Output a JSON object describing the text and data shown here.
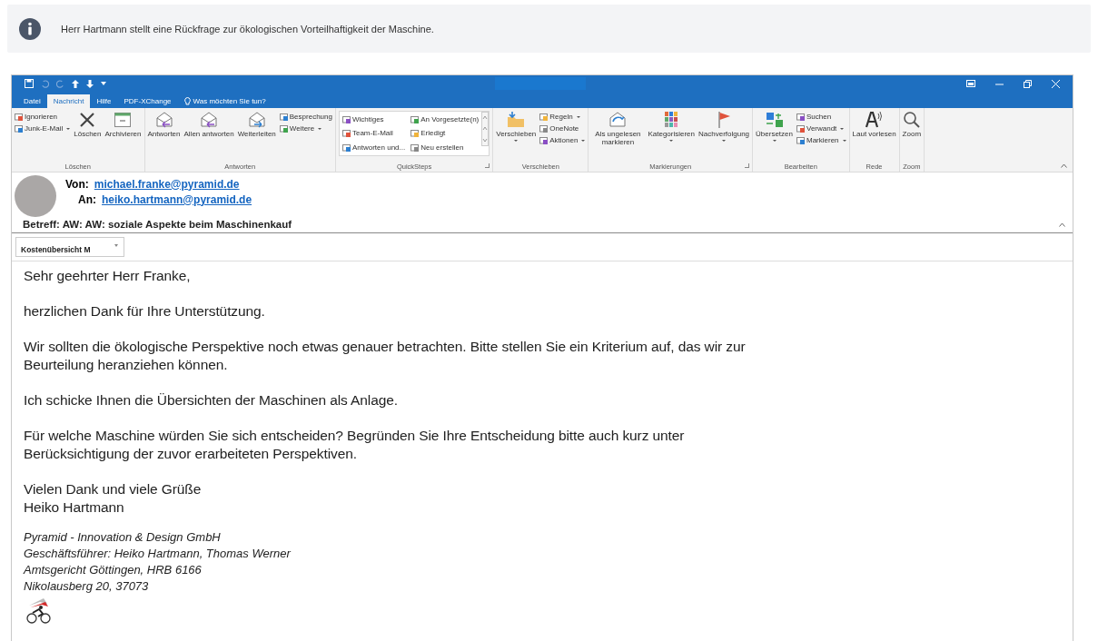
{
  "info_banner": {
    "text": "Herr Hartmann stellt eine Rückfrage zur ökologischen Vorteilhaftigkeit der Maschine."
  },
  "window": {
    "tabs": [
      {
        "label": "Datei",
        "selected": false
      },
      {
        "label": "Nachricht",
        "selected": true
      },
      {
        "label": "Hilfe",
        "selected": false
      },
      {
        "label": "PDF-XChange",
        "selected": false
      }
    ],
    "tell_me": "Was möchten Sie tun?"
  },
  "ribbon": {
    "groups": [
      {
        "label": "Löschen",
        "launcher": false,
        "items": [
          {
            "kind": "stack",
            "items": [
              {
                "label": "Ignorieren",
                "dropdown": false
              },
              {
                "label": "Junk-E-Mail",
                "dropdown": true
              }
            ]
          },
          {
            "kind": "large",
            "label": "Löschen",
            "dropdown": false
          },
          {
            "kind": "large",
            "label": "Archivieren",
            "dropdown": false
          }
        ]
      },
      {
        "label": "Antworten",
        "launcher": false,
        "items": [
          {
            "kind": "large",
            "label": "Antworten",
            "dropdown": false
          },
          {
            "kind": "large",
            "label": "Allen antworten",
            "dropdown": false
          },
          {
            "kind": "large",
            "label": "Weiterleiten",
            "dropdown": false
          },
          {
            "kind": "stack",
            "items": [
              {
                "label": "Besprechung",
                "dropdown": false
              },
              {
                "label": "Weitere",
                "dropdown": true
              }
            ]
          }
        ]
      },
      {
        "label": "QuickSteps",
        "launcher": true,
        "items": [
          {
            "kind": "gallery",
            "items": [
              {
                "label": "Wichtiges"
              },
              {
                "label": "Team-E-Mail"
              },
              {
                "label": "Antworten und..."
              },
              {
                "label": "An Vorgesetzte(n)"
              },
              {
                "label": "Erledigt"
              },
              {
                "label": "Neu erstellen"
              }
            ]
          }
        ]
      },
      {
        "label": "Verschieben",
        "launcher": false,
        "items": [
          {
            "kind": "large",
            "label": "Verschieben",
            "dropdown": true
          },
          {
            "kind": "stack",
            "items": [
              {
                "label": "Regeln",
                "dropdown": true
              },
              {
                "label": "OneNote",
                "dropdown": false
              },
              {
                "label": "Aktionen",
                "dropdown": true
              }
            ]
          }
        ]
      },
      {
        "label": "Markierungen",
        "launcher": true,
        "items": [
          {
            "kind": "large",
            "label": "Als ungelesen markieren",
            "dropdown": false
          },
          {
            "kind": "large",
            "label": "Kategorisieren",
            "dropdown": true
          },
          {
            "kind": "large",
            "label": "Nachverfolgung",
            "dropdown": true
          }
        ]
      },
      {
        "label": "Bearbeiten",
        "launcher": false,
        "items": [
          {
            "kind": "large",
            "label": "Übersetzen",
            "dropdown": true
          },
          {
            "kind": "stack",
            "items": [
              {
                "label": "Suchen",
                "dropdown": false
              },
              {
                "label": "Verwandt",
                "dropdown": true
              },
              {
                "label": "Markieren",
                "dropdown": true
              }
            ]
          }
        ]
      },
      {
        "label": "Rede",
        "launcher": false,
        "items": [
          {
            "kind": "large",
            "label": "Laut vorlesen",
            "dropdown": false
          }
        ]
      },
      {
        "label": "Zoom",
        "launcher": false,
        "items": [
          {
            "kind": "large",
            "label": "Zoom",
            "dropdown": false
          }
        ]
      }
    ]
  },
  "message": {
    "from_label": "Von:",
    "from": "michael.franke@pyramid.de",
    "to_label": "An:",
    "to": "heiko.hartmann@pyramid.de",
    "subject": "Betreff: AW: AW: soziale Aspekte beim Maschinenkauf",
    "attachment": "Kostenübersicht M",
    "body": [
      "Sehr geehrter Herr Franke,",
      "herzlichen Dank für Ihre Unterstützung.",
      "Wir sollten die ökologische Perspektive noch etwas genauer betrachten. Bitte stellen Sie ein Kriterium auf, das wir zur\nBeurteilung heranziehen können.",
      "Ich schicke Ihnen die Übersichten der Maschinen als Anlage.",
      "Für welche Maschine würden Sie sich entscheiden? Begründen Sie Ihre Entscheidung bitte auch kurz unter\nBerücksichtigung der zuvor erarbeiteten Perspektiven.",
      "Vielen Dank und viele Grüße\nHeiko Hartmann"
    ],
    "signature": [
      "Pyramid - Innovation & Design GmbH",
      "Geschäftsführer: Heiko Hartmann, Thomas Werner",
      "Amtsgericht Göttingen, HRB 6166",
      "Nikolausberg 20, 37073"
    ]
  }
}
